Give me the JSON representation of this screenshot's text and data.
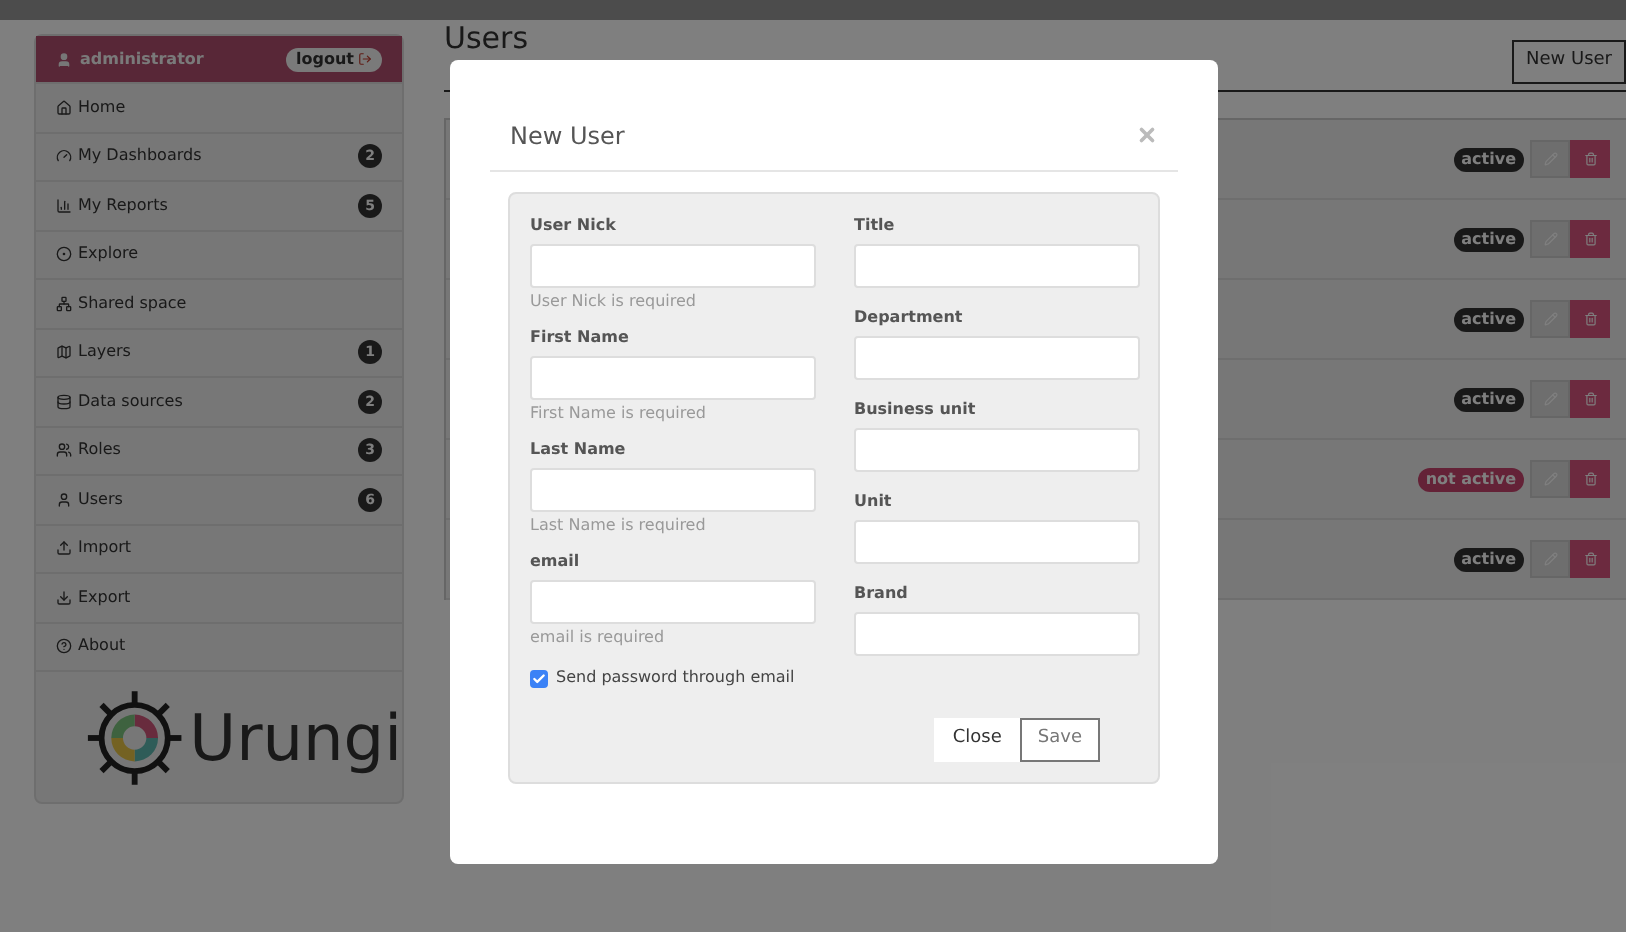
{
  "user": {
    "name": "administrator",
    "logout": "logout"
  },
  "sidebar": {
    "items": [
      {
        "label": "Home"
      },
      {
        "label": "My Dashboards",
        "badge": "2"
      },
      {
        "label": "My Reports",
        "badge": "5"
      },
      {
        "label": "Explore"
      },
      {
        "label": "Shared space"
      },
      {
        "label": "Layers",
        "badge": "1"
      },
      {
        "label": "Data sources",
        "badge": "2"
      },
      {
        "label": "Roles",
        "badge": "3"
      },
      {
        "label": "Users",
        "badge": "6"
      },
      {
        "label": "Import"
      },
      {
        "label": "Export"
      },
      {
        "label": "About"
      }
    ],
    "logo_text": "Urungi"
  },
  "main": {
    "title": "Users",
    "new_button": "New User",
    "rows": [
      {
        "status": "active",
        "active": true
      },
      {
        "status": "active",
        "active": true
      },
      {
        "status": "active",
        "active": true
      },
      {
        "status": "active",
        "active": true
      },
      {
        "status": "not active",
        "active": false
      },
      {
        "status": "active",
        "active": true
      }
    ]
  },
  "modal": {
    "title": "New User",
    "left_fields": [
      {
        "label": "User Nick",
        "hint": "User Nick is required"
      },
      {
        "label": "First Name",
        "hint": "First Name is required"
      },
      {
        "label": "Last Name",
        "hint": "Last Name is required"
      },
      {
        "label": "email",
        "hint": "email is required"
      }
    ],
    "right_fields": [
      {
        "label": "Title"
      },
      {
        "label": "Department"
      },
      {
        "label": "Business unit"
      },
      {
        "label": "Unit"
      },
      {
        "label": "Brand"
      }
    ],
    "checkbox": {
      "label": "Send password through email",
      "checked": true
    },
    "buttons": [
      "Close",
      "Save"
    ]
  }
}
